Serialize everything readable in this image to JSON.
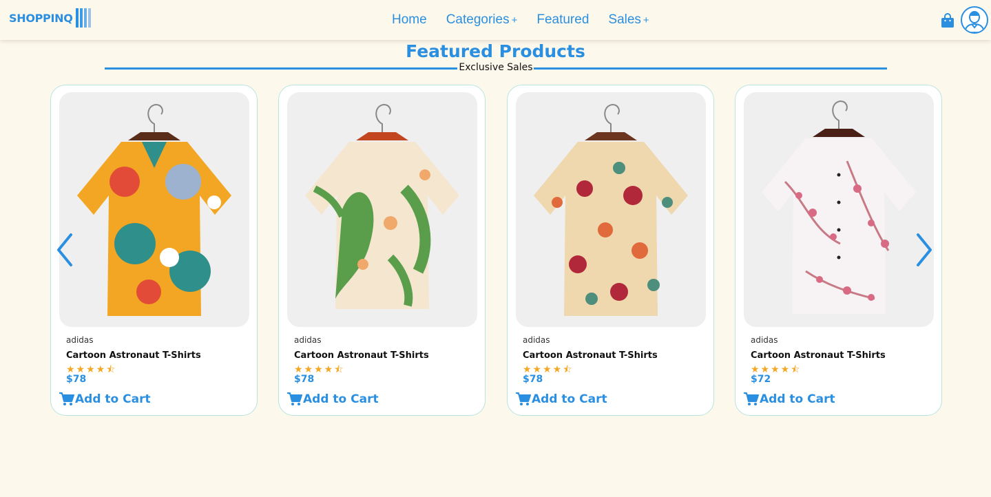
{
  "header": {
    "logo_text": "SHOPPINQ",
    "nav": [
      {
        "label": "Home",
        "has_plus": false
      },
      {
        "label": "Categories",
        "has_plus": true
      },
      {
        "label": "Featured",
        "has_plus": false
      },
      {
        "label": "Sales",
        "has_plus": true
      }
    ],
    "plus_symbol": "+",
    "cart_icon": "shopping-bag-icon",
    "avatar_icon": "user-avatar-icon"
  },
  "section": {
    "title": "Featured Products",
    "subtitle": "Exclusive Sales"
  },
  "carousel": {
    "prev_icon": "chevron-left-icon",
    "next_icon": "chevron-right-icon"
  },
  "products": [
    {
      "brand": "adidas",
      "name": "Cartoon Astronaut T-Shirts",
      "rating": 4.5,
      "stars": "★★★★⯪",
      "price": "$78",
      "cta": "Add to Cart",
      "pattern": "cartoon"
    },
    {
      "brand": "adidas",
      "name": "Cartoon Astronaut T-Shirts",
      "rating": 4.5,
      "stars": "★★★★⯪",
      "price": "$78",
      "cta": "Add to Cart",
      "pattern": "tropical"
    },
    {
      "brand": "adidas",
      "name": "Cartoon Astronaut T-Shirts",
      "rating": 4.5,
      "stars": "★★★★⯪",
      "price": "$78",
      "cta": "Add to Cart",
      "pattern": "floral"
    },
    {
      "brand": "adidas",
      "name": "Cartoon Astronaut T-Shirts",
      "rating": 4.5,
      "stars": "★★★★⯪",
      "price": "$72",
      "cta": "Add to Cart",
      "pattern": "blossom"
    }
  ],
  "colors": {
    "accent": "#2a8fe0",
    "background": "#fdf8ec",
    "star": "#f5a623",
    "card_border": "#b9e4df"
  }
}
